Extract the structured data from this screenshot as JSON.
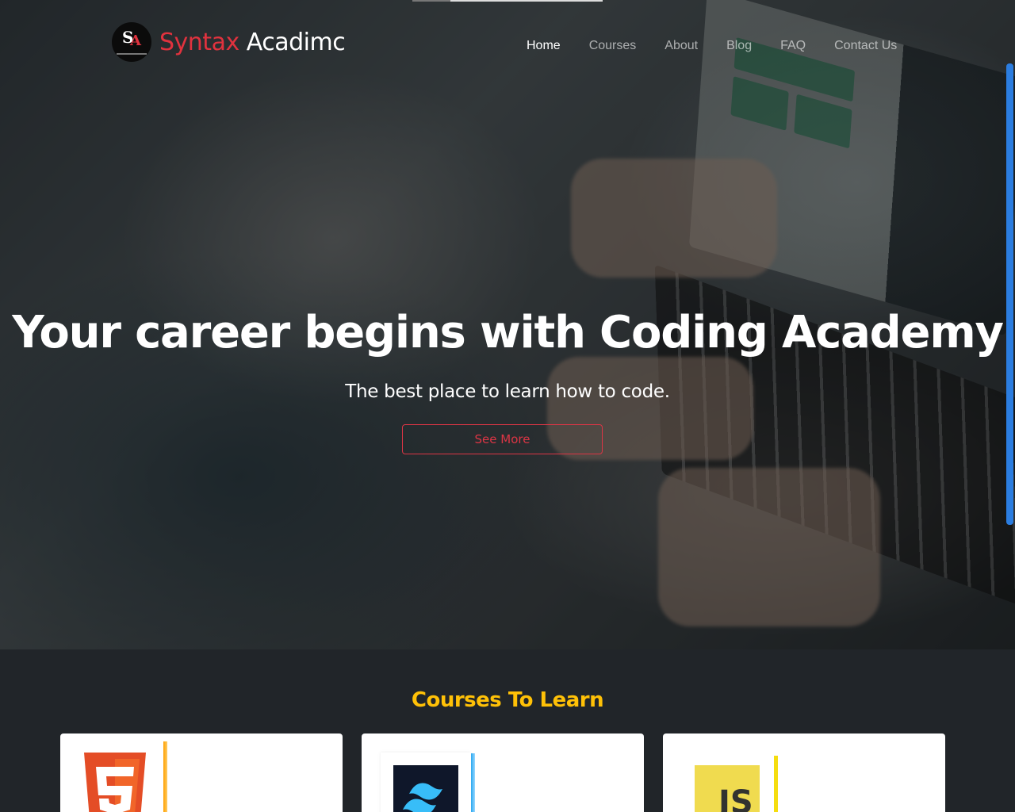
{
  "brand": {
    "name_part1": "Syntax",
    "name_part2": "Acadimc",
    "logo_initials_1": "S",
    "logo_initials_2": "A"
  },
  "nav": {
    "items": [
      "Home",
      "Courses",
      "About",
      "Blog",
      "FAQ",
      "Contact Us"
    ],
    "active": "Home"
  },
  "hero": {
    "title": "Your career begins with Coding Academy",
    "subtitle": "The best place to learn how to code.",
    "button_label": "See More"
  },
  "courses": {
    "title": "Courses To Learn",
    "cards": [
      {
        "icon": "html5-icon",
        "accent": "#ffa000"
      },
      {
        "icon": "tailwind-icon",
        "accent": "#2aa8f0"
      },
      {
        "icon": "js-icon",
        "accent": "#f5dd10",
        "icon_text": "JS"
      }
    ]
  },
  "colors": {
    "brand_red": "#e0323e",
    "section_bg": "#212529",
    "title_yellow": "#ffc107",
    "button_red": "#dc3545"
  }
}
